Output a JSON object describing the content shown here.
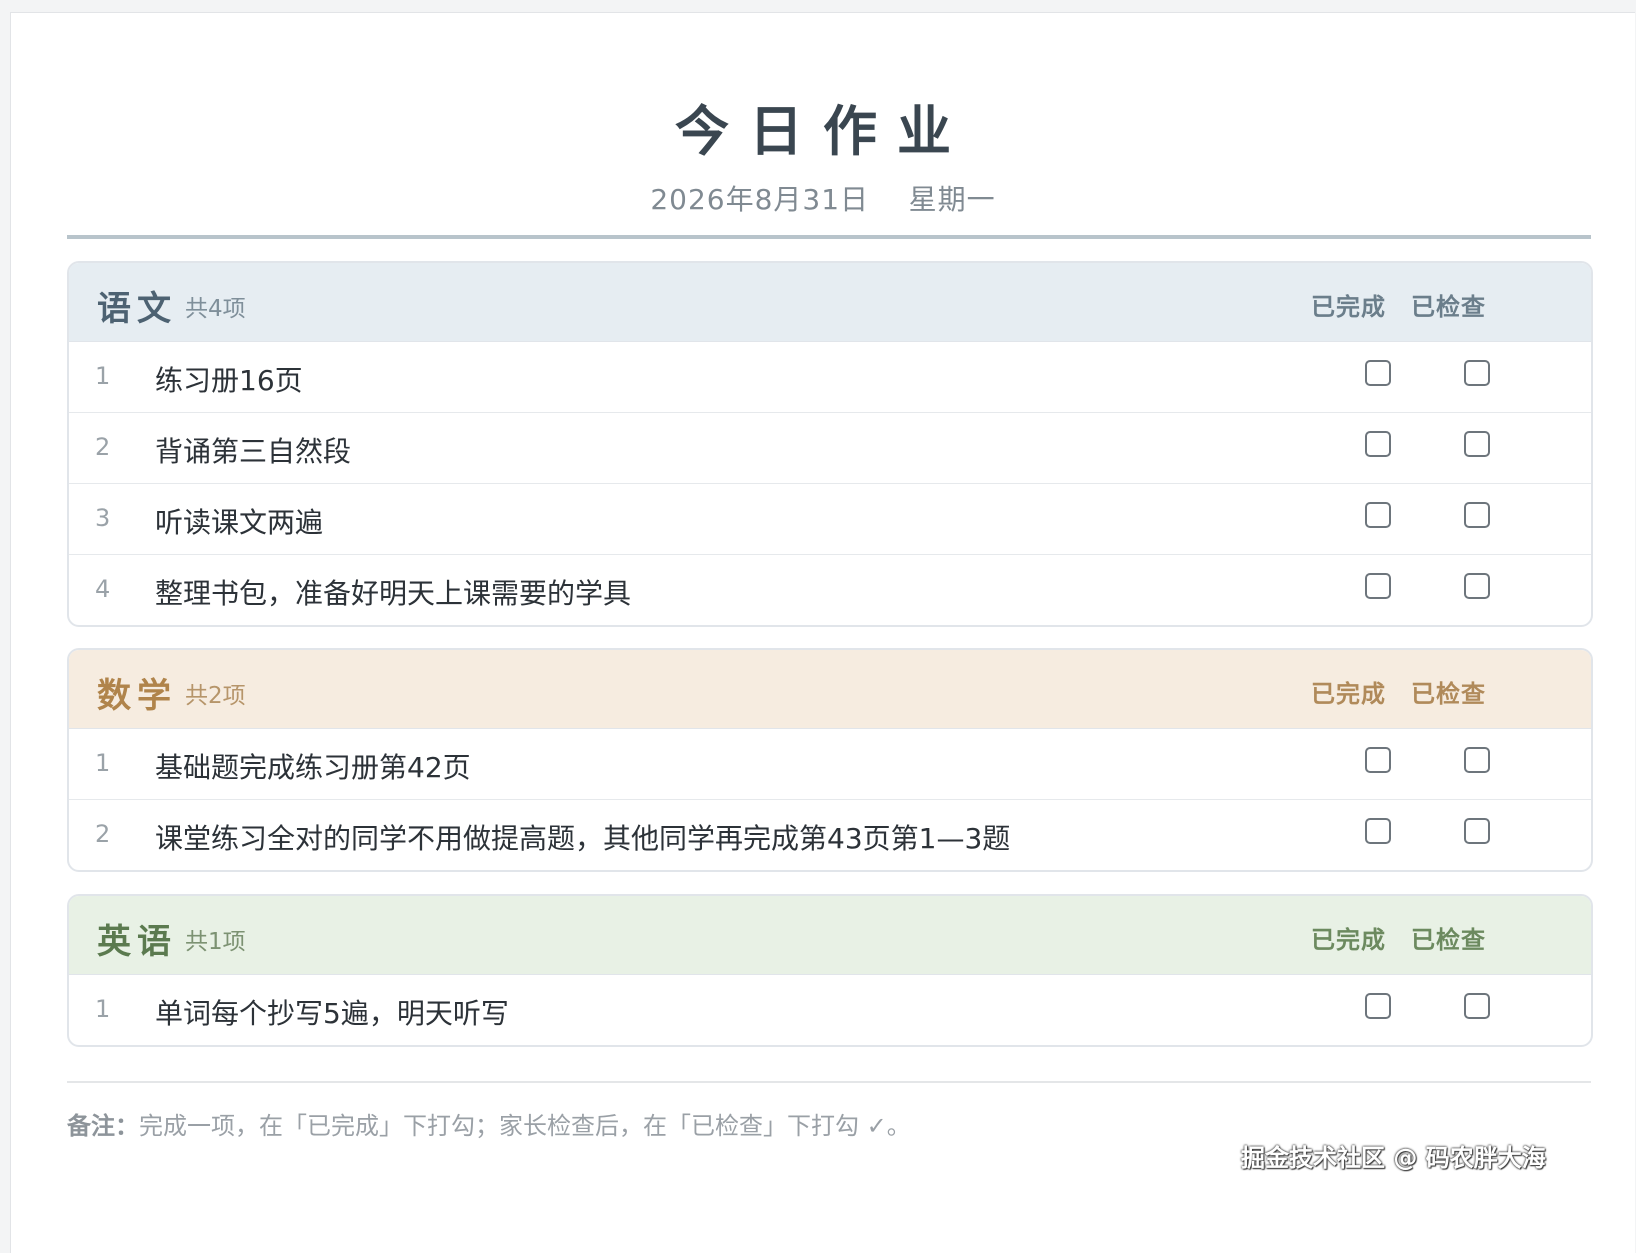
{
  "header": {
    "title": "今日作业",
    "date": "2026年8月31日    星期一"
  },
  "sections": [
    {
      "name": "语文",
      "count": "共4项",
      "col_done": "已完成",
      "col_checked": "已检查",
      "items": [
        {
          "num": "1",
          "text": "练习册16页",
          "done": false,
          "checked": false
        },
        {
          "num": "2",
          "text": "背诵第三自然段",
          "done": false,
          "checked": false
        },
        {
          "num": "3",
          "text": "听读课文两遍",
          "done": false,
          "checked": false
        },
        {
          "num": "4",
          "text": "整理书包，准备好明天上课需要的学具",
          "done": false,
          "checked": false
        }
      ]
    },
    {
      "name": "数学",
      "count": "共2项",
      "col_done": "已完成",
      "col_checked": "已检查",
      "items": [
        {
          "num": "1",
          "text": "基础题完成练习册第42页",
          "done": false,
          "checked": false
        },
        {
          "num": "2",
          "text": "课堂练习全对的同学不用做提高题，其他同学再完成第43页第1—3题",
          "done": false,
          "checked": false
        }
      ]
    },
    {
      "name": "英语",
      "count": "共1项",
      "col_done": "已完成",
      "col_checked": "已检查",
      "items": [
        {
          "num": "1",
          "text": "单词每个抄写5遍，明天听写",
          "done": false,
          "checked": false
        }
      ]
    }
  ],
  "footer": {
    "note_label": "备注：",
    "note_text": "完成一项，在「已完成」下打勾；家长检查后，在「已检查」下打勾 ✓。",
    "watermark": "掘金技术社区 @ 码农胖大海"
  }
}
